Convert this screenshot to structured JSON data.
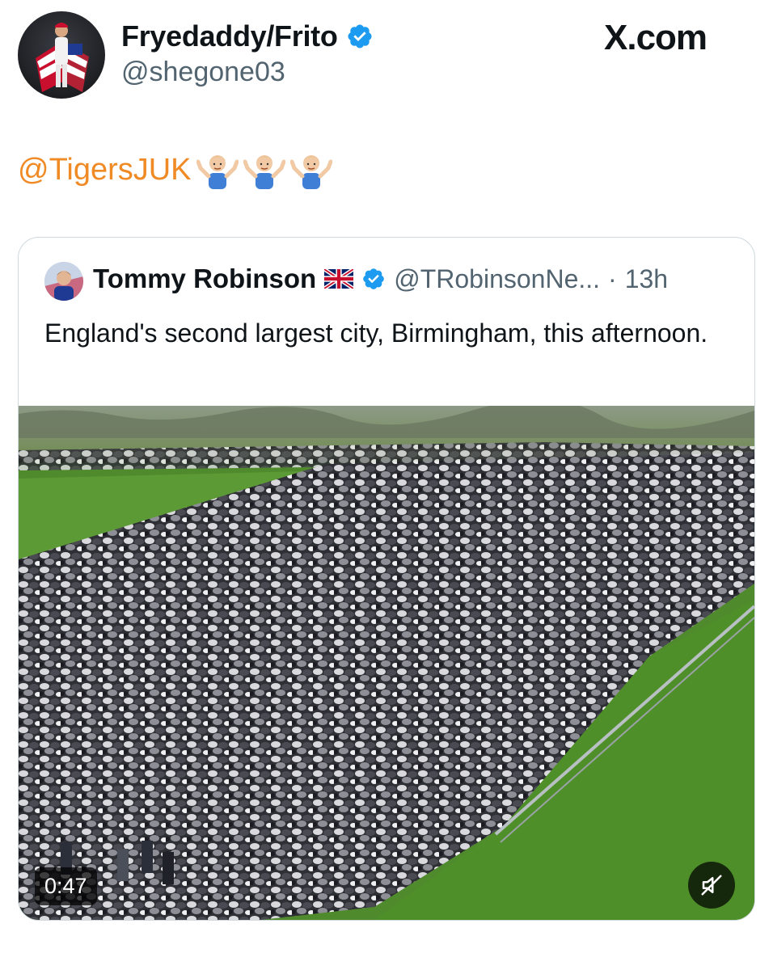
{
  "author": {
    "display_name": "Fryedaddy/Frito",
    "handle": "@shegone03",
    "verified": true,
    "avatar_icon": "avatar-photo"
  },
  "brand": {
    "label": "X.com"
  },
  "tweet": {
    "mention": "@TigersJUK",
    "emojis": [
      "man-shrugging-emoji",
      "man-shrugging-emoji",
      "man-shrugging-emoji"
    ]
  },
  "quoted_tweet": {
    "display_name": "Tommy Robinson",
    "flag_icon": "uk-flag-icon",
    "verified": true,
    "handle": "@TRobinsonNe...",
    "separator": "·",
    "time": "13h",
    "text": "England's second largest city, Birmingham, this afternoon.",
    "video": {
      "duration": "0:47",
      "muted": true
    }
  },
  "colors": {
    "verified_blue": "#1d9bf0",
    "mention_orange": "#f08a24",
    "secondary_text": "#536471",
    "border": "#cfd9de"
  }
}
